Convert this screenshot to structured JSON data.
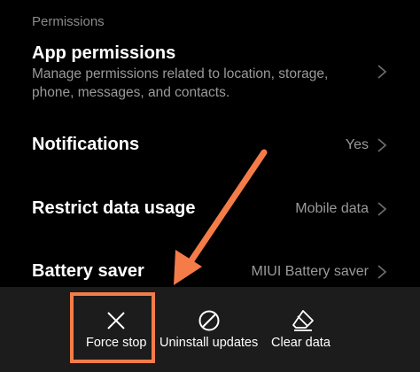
{
  "section": {
    "header": "Permissions"
  },
  "rows": [
    {
      "title": "App permissions",
      "description": "Manage permissions related to location, storage, phone, messages, and contacts.",
      "value": ""
    },
    {
      "title": "Notifications",
      "description": "",
      "value": "Yes"
    },
    {
      "title": "Restrict data usage",
      "description": "",
      "value": "Mobile data"
    },
    {
      "title": "Battery saver",
      "description": "",
      "value": "MIUI Battery saver"
    }
  ],
  "actions": {
    "force_stop": {
      "label": "Force stop",
      "icon": "close-icon"
    },
    "uninstall_updates": {
      "label": "Uninstall updates",
      "icon": "prohibited-icon"
    },
    "clear_data": {
      "label": "Clear data",
      "icon": "eraser-icon"
    }
  },
  "colors": {
    "background": "#000000",
    "bottom_bar": "#1c1c1c",
    "secondary_text": "#9a9a9a",
    "annotation": "#f47c48"
  }
}
